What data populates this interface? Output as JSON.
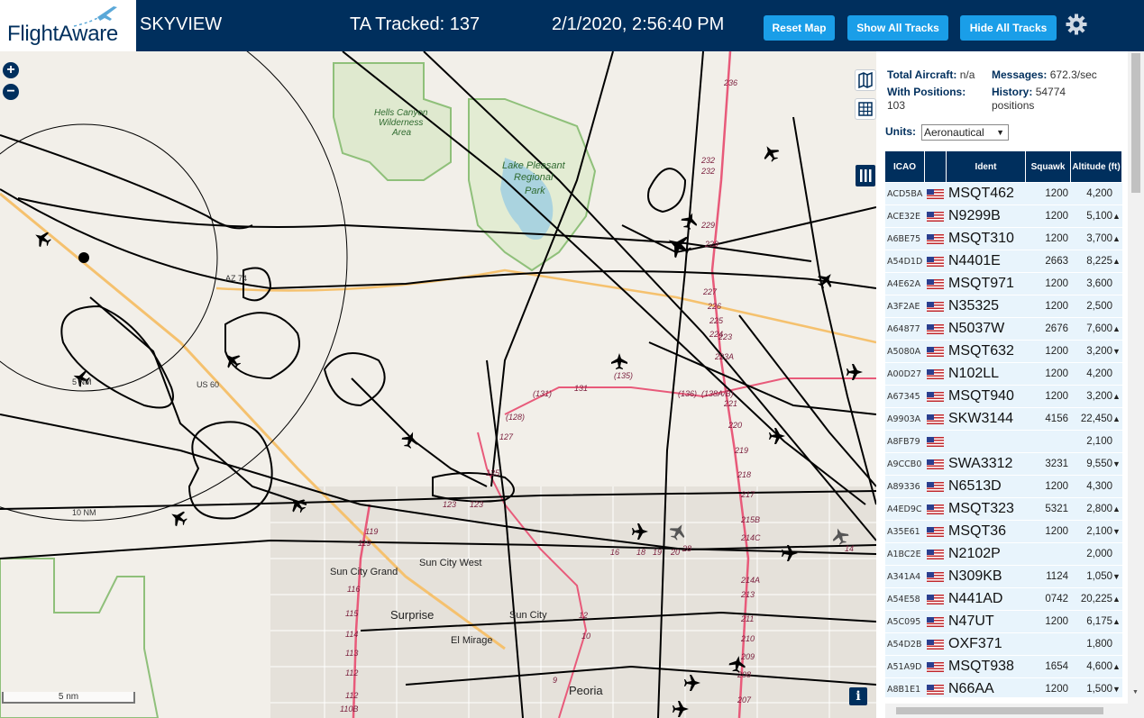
{
  "header": {
    "logo_text": "FlightAware",
    "app_name": "SKYVIEW",
    "tracked": "TA Tracked: 137",
    "clock": "2/1/2020, 2:56:40 PM",
    "reset_label": "Reset Map",
    "show_all_label": "Show All Tracks",
    "hide_all_label": "Hide All Tracks"
  },
  "map": {
    "zoom_in": "+",
    "zoom_out": "−",
    "info": "i",
    "scale_label": "5 nm",
    "places": [
      "Hells Canyon",
      "Wilderness",
      "Area",
      "Lake Pleasant",
      "Regional",
      "Park",
      "Sun City Grand",
      "Sun City West",
      "Surprise",
      "Sun City",
      "El Mirage",
      "Peoria"
    ],
    "route_labels": [
      "AZ 74",
      "US 60",
      "10 NM",
      "5 NM",
      "236",
      "232",
      "232",
      "229",
      "229",
      "227",
      "226",
      "225",
      "224",
      "223",
      "223A",
      "221",
      "220",
      "219",
      "218",
      "217",
      "215B",
      "214C",
      "214A",
      "213",
      "211",
      "210",
      "209",
      "208",
      "207",
      "(136)",
      "(138A/B)",
      "(135)",
      "(131)",
      "131",
      "(128)",
      "127",
      "125",
      "123",
      "123",
      "119",
      "119",
      "116",
      "115",
      "114",
      "113",
      "112",
      "112",
      "110B",
      "16",
      "18",
      "19",
      "20",
      "28",
      "14",
      "12",
      "10",
      "9"
    ]
  },
  "panel": {
    "total_aircraft_label": "Total Aircraft:",
    "total_aircraft_value": "n/a",
    "messages_label": "Messages:",
    "messages_value": "672.3/sec",
    "with_positions_label": "With Positions:",
    "with_positions_value": "103",
    "history_label": "History:",
    "history_value": "54774",
    "history_unit": "positions",
    "units_label": "Units:",
    "units_value": "Aeronautical",
    "columns": [
      "ICAO",
      "",
      "Ident",
      "Squawk",
      "Altitude (ft)"
    ],
    "rows": [
      {
        "icao": "ACD5BA",
        "ident": "MSQT462",
        "squawk": "1200",
        "alt": "4,200",
        "trend": ""
      },
      {
        "icao": "ACE32E",
        "ident": "N9299B",
        "squawk": "1200",
        "alt": "5,100",
        "trend": "▲"
      },
      {
        "icao": "A6BE75",
        "ident": "MSQT310",
        "squawk": "1200",
        "alt": "3,700",
        "trend": "▲"
      },
      {
        "icao": "A54D1D",
        "ident": "N4401E",
        "squawk": "2663",
        "alt": "8,225",
        "trend": "▲"
      },
      {
        "icao": "A4E62A",
        "ident": "MSQT971",
        "squawk": "1200",
        "alt": "3,600",
        "trend": ""
      },
      {
        "icao": "A3F2AE",
        "ident": "N35325",
        "squawk": "1200",
        "alt": "2,500",
        "trend": ""
      },
      {
        "icao": "A64877",
        "ident": "N5037W",
        "squawk": "2676",
        "alt": "7,600",
        "trend": "▲"
      },
      {
        "icao": "A5080A",
        "ident": "MSQT632",
        "squawk": "1200",
        "alt": "3,200",
        "trend": "▼"
      },
      {
        "icao": "A00D27",
        "ident": "N102LL",
        "squawk": "1200",
        "alt": "4,200",
        "trend": ""
      },
      {
        "icao": "A67345",
        "ident": "MSQT940",
        "squawk": "1200",
        "alt": "3,200",
        "trend": "▲"
      },
      {
        "icao": "A9903A",
        "ident": "SKW3144",
        "squawk": "4156",
        "alt": "22,450",
        "trend": "▲"
      },
      {
        "icao": "A8FB79",
        "ident": "",
        "squawk": "",
        "alt": "2,100",
        "trend": ""
      },
      {
        "icao": "A9CCB0",
        "ident": "SWA3312",
        "squawk": "3231",
        "alt": "9,550",
        "trend": "▼"
      },
      {
        "icao": "A89336",
        "ident": "N6513D",
        "squawk": "1200",
        "alt": "4,300",
        "trend": ""
      },
      {
        "icao": "A4ED9C",
        "ident": "MSQT323",
        "squawk": "5321",
        "alt": "2,800",
        "trend": "▲"
      },
      {
        "icao": "A35E61",
        "ident": "MSQT36",
        "squawk": "1200",
        "alt": "2,100",
        "trend": "▼"
      },
      {
        "icao": "A1BC2E",
        "ident": "N2102P",
        "squawk": "",
        "alt": "2,000",
        "trend": ""
      },
      {
        "icao": "A341A4",
        "ident": "N309KB",
        "squawk": "1124",
        "alt": "1,050",
        "trend": "▼"
      },
      {
        "icao": "A54E58",
        "ident": "N441AD",
        "squawk": "0742",
        "alt": "20,225",
        "trend": "▲"
      },
      {
        "icao": "A5C095",
        "ident": "N47UT",
        "squawk": "1200",
        "alt": "6,175",
        "trend": "▲"
      },
      {
        "icao": "A54D2B",
        "ident": "OXF371",
        "squawk": "",
        "alt": "1,800",
        "trend": ""
      },
      {
        "icao": "A51A9D",
        "ident": "MSQT938",
        "squawk": "1654",
        "alt": "4,600",
        "trend": "▲"
      },
      {
        "icao": "A8B1E1",
        "ident": "N66AA",
        "squawk": "1200",
        "alt": "1,500",
        "trend": "▼"
      }
    ]
  },
  "colors": {
    "header_bg": "#002f5d",
    "button_bg": "#1a9ee8",
    "row_bg": "#e8f4fc",
    "track": "#000000",
    "highway": "#e85a7a",
    "park_border": "#8fc07a"
  },
  "icons": [
    "plane-logo-icon",
    "gear-icon",
    "zoom-in-icon",
    "zoom-out-icon",
    "map-layers-icon",
    "grid-icon",
    "columns-icon",
    "info-icon",
    "aircraft-icon",
    "us-flag-icon"
  ]
}
